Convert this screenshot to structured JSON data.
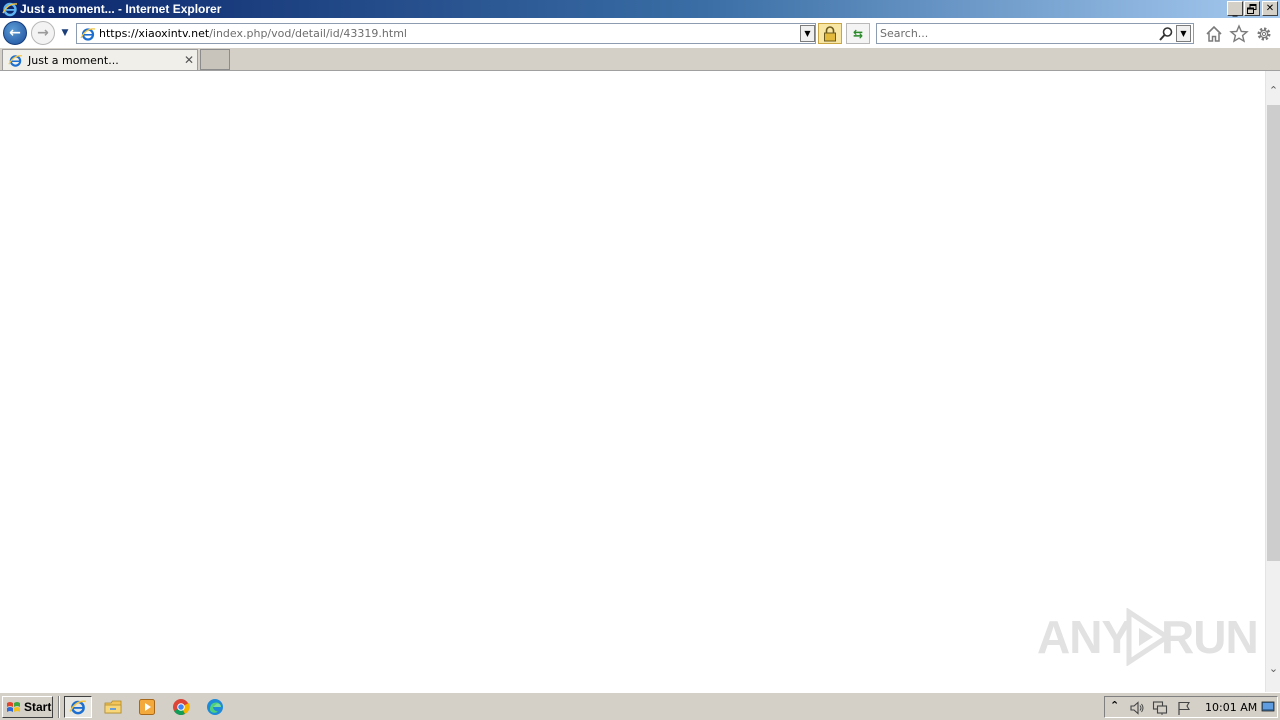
{
  "window": {
    "title": "Just a moment... - Internet Explorer"
  },
  "titlebar_buttons": {
    "minimize": "minimize-icon",
    "restore": "restore-icon",
    "close": "close-icon"
  },
  "navbar": {
    "back": "back-arrow-icon",
    "forward": "forward-arrow-icon",
    "address": {
      "host_part": "https://xiaoxintv.net",
      "path_part": "/index.php/vod/detail/id/43319.html"
    },
    "search": {
      "placeholder": "Search..."
    },
    "icons": [
      "home-icon",
      "favorites-star-icon",
      "tools-gear-icon"
    ]
  },
  "tabs": [
    {
      "label": "Just a moment...",
      "active": true
    }
  ],
  "watermark": {
    "left": "ANY",
    "right": "RUN"
  },
  "taskbar": {
    "start_label": "Start",
    "pinned": [
      "internet-explorer-icon",
      "file-explorer-icon",
      "media-player-icon",
      "chrome-icon",
      "edge-icon"
    ],
    "clock": "10:01 AM"
  },
  "colors": {
    "titlebar_dark": "#0a246a",
    "titlebar_light": "#a6caf0",
    "chrome_gray": "#d4d0c8",
    "ie_blue": "#1c6fd0"
  }
}
